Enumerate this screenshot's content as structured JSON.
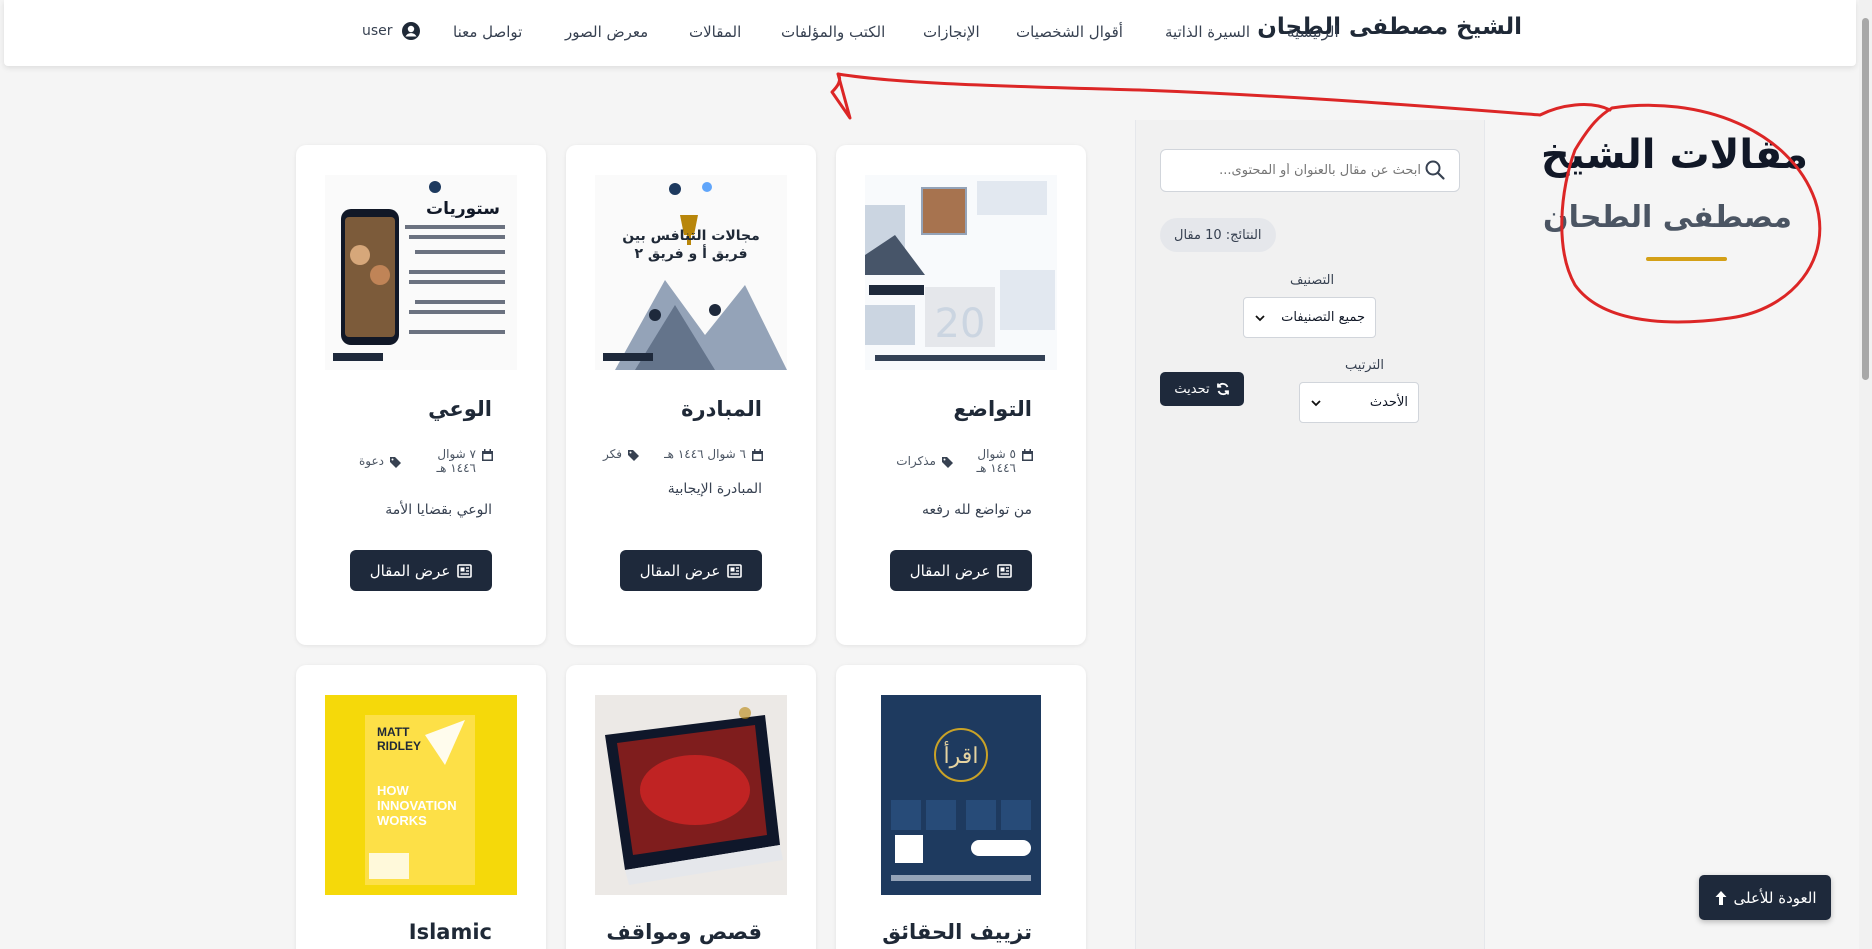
{
  "navbar": {
    "brand": "الشيخ مصطفى الطحان",
    "items": [
      "الرئيسية",
      "السيرة الذاتية",
      "أقوال الشخصيات",
      "الإنجازات",
      "الكتب والمؤلفات",
      "المقالات",
      "معرض الصور",
      "تواصل معنا"
    ],
    "user_label": "user"
  },
  "heading": {
    "title": "مقالات الشيخ",
    "subtitle": "مصطفى الطحان"
  },
  "sidebar": {
    "search_placeholder": "ابحث عن مقال بالعنوان أو المحتوى...",
    "results": "النتائج: 10 مقال",
    "category_label": "التصنيف",
    "category_value": "جميع التصنيفات",
    "sort_label": "الترتيب",
    "sort_value": "الأحدث",
    "refresh_label": "تحديث"
  },
  "cards": [
    {
      "title": "التواضع",
      "date": "٥ شوال ١٤٤٦ هـ",
      "category": "مذكرات",
      "excerpt": "من تواضع لله رفعه",
      "button": "عرض المقال"
    },
    {
      "title": "المبادرة",
      "date": "٦ شوال ١٤٤٦ هـ",
      "category": "فكر",
      "excerpt": "المبادرة الإيجابية",
      "button": "عرض المقال",
      "poster_title": "مجالات التنافس بين فريق أ و فريق ٢"
    },
    {
      "title": "الوعي",
      "date": "٧ شوال ١٤٤٦ هـ",
      "category": "دعوة",
      "excerpt": "الوعي بقضايا الأمة",
      "button": "عرض المقال",
      "poster_title": "ستوريات"
    },
    {
      "title": "تزييف الحقائق"
    },
    {
      "title": "قصص ومواقف"
    },
    {
      "title": "Islamic",
      "book_author": "MATT RIDLEY",
      "book_title": "HOW INNOVATION WORKS"
    }
  ],
  "back_to_top": "العودة للأعلى",
  "colors": {
    "primary_dark": "#1e293b",
    "accent_gold": "#d4a017",
    "annotation_red": "#dc2626",
    "page_bg": "#f5f5f5"
  }
}
